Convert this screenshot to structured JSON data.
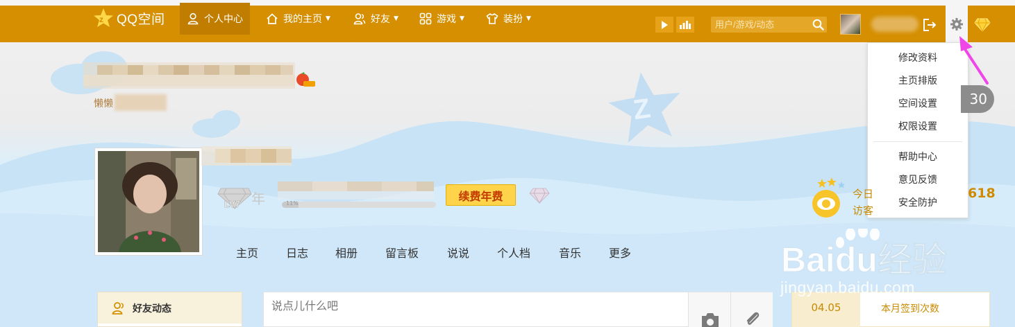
{
  "topbar": {
    "logo_text": "QQ空间",
    "nav": [
      {
        "label": "个人中心",
        "icon": "user-icon",
        "active": true
      },
      {
        "label": "我的主页",
        "icon": "home-icon",
        "dropdown": true
      },
      {
        "label": "好友",
        "icon": "friends-icon",
        "dropdown": true
      },
      {
        "label": "游戏",
        "icon": "apps-grid-icon",
        "dropdown": true
      },
      {
        "label": "装扮",
        "icon": "tshirt-icon",
        "dropdown": true
      }
    ],
    "search_placeholder": "用户/游戏/动态",
    "accent_color": "#d58f00"
  },
  "settings_menu": {
    "items": [
      "修改资料",
      "主页排版",
      "空间设置",
      "权限设置"
    ],
    "items2": [
      "帮助中心",
      "意见反馈",
      "安全防护"
    ]
  },
  "profile": {
    "mood_prefix": "懒懒",
    "level": "LV7",
    "year_label": "年",
    "progress_fraction": 0.11,
    "progress_label": "11%",
    "renew_label": "续费年费"
  },
  "tabs": [
    "主页",
    "日志",
    "相册",
    "留言板",
    "说说",
    "个人档",
    "音乐",
    "更多"
  ],
  "stats": {
    "badge_count": "30",
    "today_label": "今日",
    "visitor_label": "访客",
    "total": "618"
  },
  "feed": {
    "friend_feed_label": "好友动态",
    "post_placeholder": "说点儿什么吧"
  },
  "checkin": {
    "date": "04.05",
    "label": "本月签到次数"
  },
  "watermark": {
    "brand": "Baidu经验",
    "url": "jingyan.baidu.com"
  }
}
